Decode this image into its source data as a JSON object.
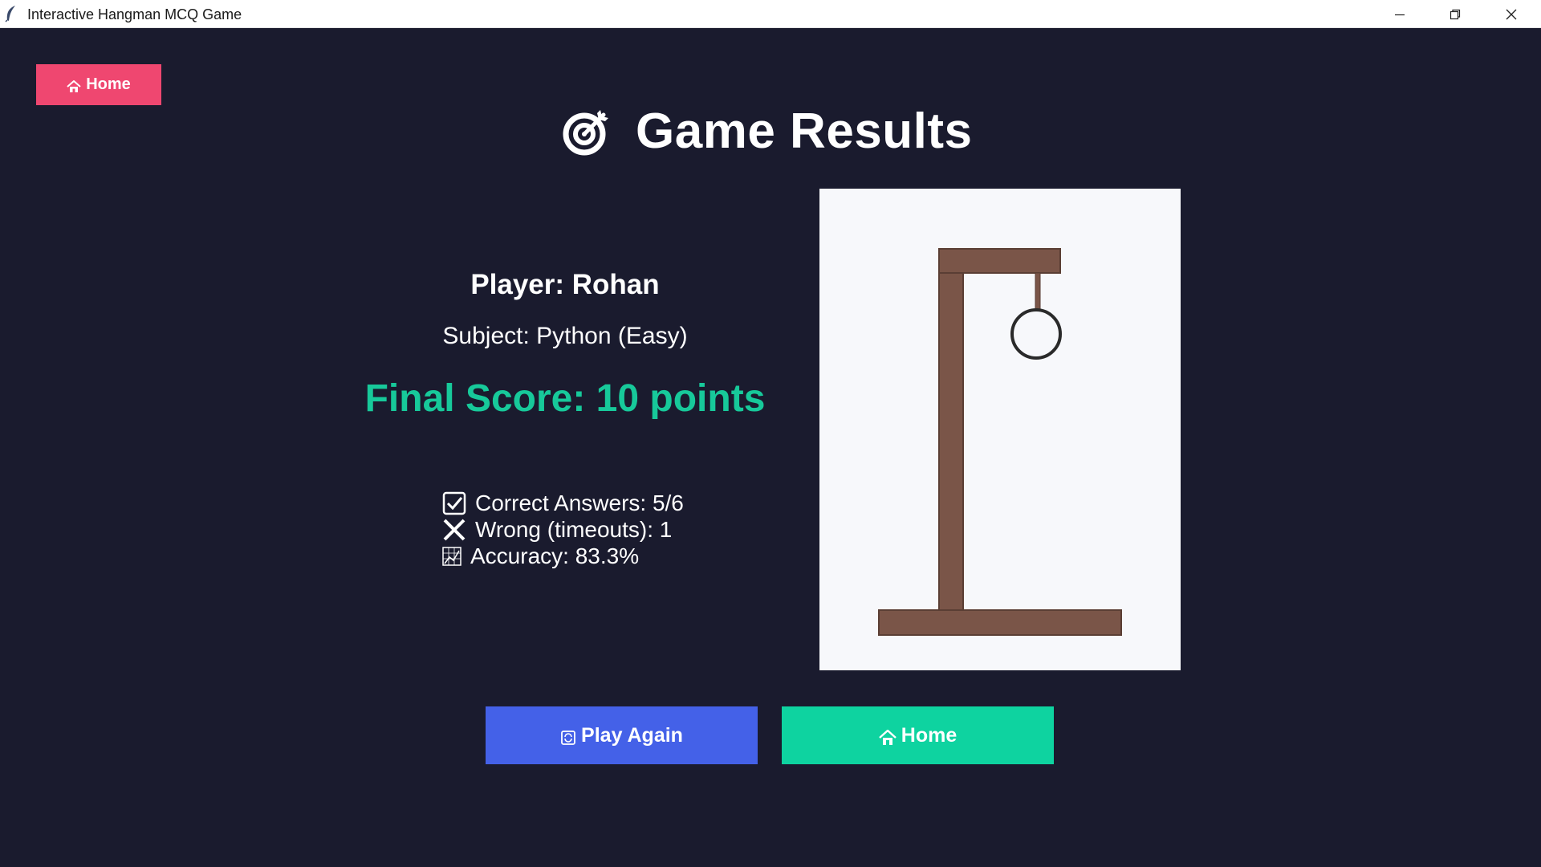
{
  "window": {
    "title": "Interactive Hangman MCQ Game",
    "controls": [
      "minimize-icon",
      "restore-icon",
      "close-icon"
    ]
  },
  "nav": {
    "home_label": "Home",
    "home_icon": "home-icon"
  },
  "results": {
    "heading": "Game Results",
    "heading_icon": "target-icon",
    "player": "Player: Rohan",
    "subject": "Subject: Python (Easy)",
    "final_score": "Final Score: 10 points",
    "stats": {
      "correct": "Correct Answers: 5/6",
      "wrong": "Wrong (timeouts): 1",
      "accuracy": "Accuracy: 83.3%"
    }
  },
  "hangman": {
    "wrong_count": 1,
    "parts_drawn": [
      "gallows",
      "head"
    ]
  },
  "actions": {
    "play_again_label": "Play Again",
    "play_again_icon": "replay-icon",
    "home_label": "Home",
    "home_icon": "home-icon"
  },
  "colors": {
    "background": "#1a1b2e",
    "home_top": "#ef4770",
    "score": "#17c99a",
    "play_again": "#4461e8",
    "home_bottom": "#0ed3a0",
    "wood": "#7a5548",
    "canvas": "#f7f8fb"
  }
}
